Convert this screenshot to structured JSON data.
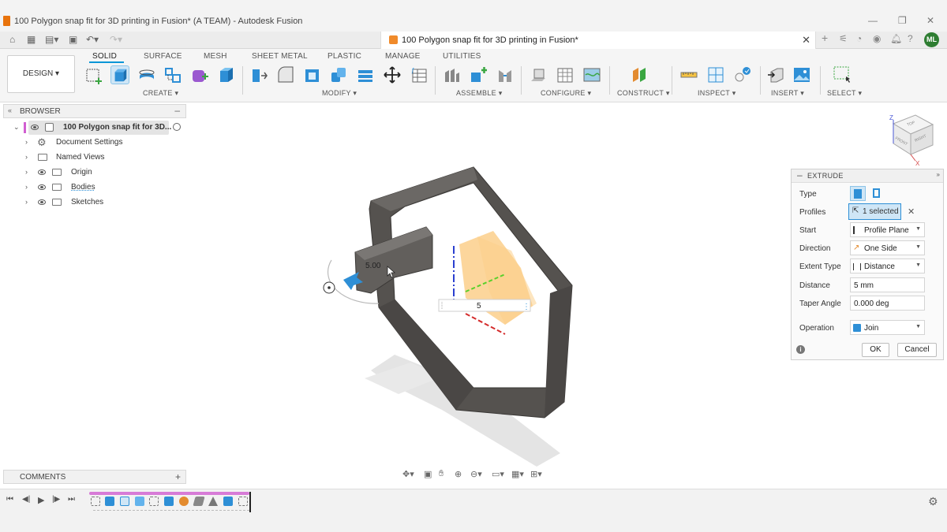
{
  "window": {
    "title": "100 Polygon snap fit for 3D printing in Fusion* (A TEAM) - Autodesk Fusion",
    "controls": [
      "—",
      "❐",
      "✕"
    ]
  },
  "tab": {
    "doc_title": "100 Polygon snap fit for 3D printing in Fusion*",
    "close": "✕",
    "avatar": "ML"
  },
  "ribbon": {
    "workspace": "DESIGN ▾",
    "tabs": [
      "SOLID",
      "SURFACE",
      "MESH",
      "SHEET METAL",
      "PLASTIC",
      "MANAGE",
      "UTILITIES"
    ],
    "groups": [
      "CREATE ▾",
      "MODIFY ▾",
      "ASSEMBLE ▾",
      "CONFIGURE ▾",
      "CONSTRUCT ▾",
      "INSPECT ▾",
      "INSERT ▾",
      "SELECT ▾"
    ]
  },
  "browser": {
    "title": "BROWSER",
    "items": [
      {
        "label": "100 Polygon snap fit for 3D..."
      },
      {
        "label": "Document Settings"
      },
      {
        "label": "Named Views"
      },
      {
        "label": "Origin"
      },
      {
        "label": "Bodies"
      },
      {
        "label": "Sketches"
      }
    ]
  },
  "viewport": {
    "dim_label": "5.00",
    "input_value": "5",
    "viewcube": {
      "top": "TOP",
      "front": "FRONT",
      "right": "RIGHT",
      "z": "Z",
      "x": "X"
    }
  },
  "extrude": {
    "title": "EXTRUDE",
    "rows": [
      {
        "label": "Type"
      },
      {
        "label": "Profiles",
        "value": "1 selected"
      },
      {
        "label": "Start",
        "value": "Profile Plane"
      },
      {
        "label": "Direction",
        "value": "One Side"
      },
      {
        "label": "Extent Type",
        "value": "Distance"
      },
      {
        "label": "Distance",
        "value": "5 mm"
      },
      {
        "label": "Taper Angle",
        "value": "0.000 deg"
      },
      {
        "label": "Operation",
        "value": "Join"
      }
    ],
    "ok": "OK",
    "cancel": "Cancel"
  },
  "comments": {
    "title": "COMMENTS"
  },
  "colors": {
    "accent": "#0696d7",
    "body": "#5a5754",
    "profile": "#f9b44a"
  }
}
